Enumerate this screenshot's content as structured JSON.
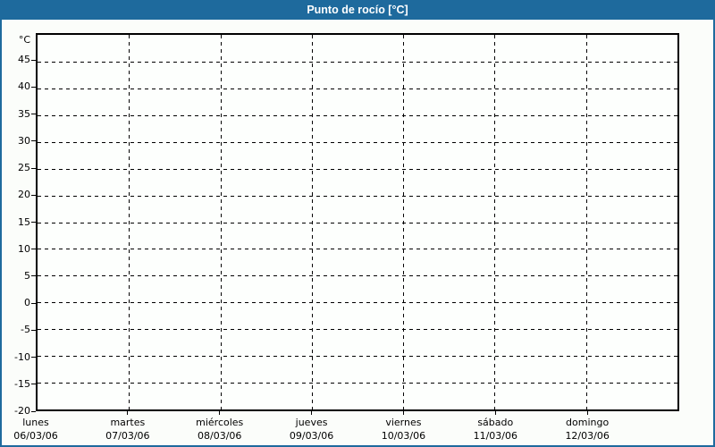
{
  "colors": {
    "frame_blue": "#1e6a9d",
    "title_text": "#ffffff",
    "background": "#fbfdfa",
    "plot_background": "#fdfffd",
    "axis_and_grid": "#000000"
  },
  "chart_data": {
    "type": "line",
    "title": "Punto de rocío [°C]",
    "grid": "dashed-black-horizontal-and-vertical",
    "legend_position": "none",
    "y_axis": {
      "unit_label": "°C",
      "min": -20,
      "max": 50,
      "tick_step": 5,
      "tick_labels": [
        "45",
        "40",
        "35",
        "30",
        "25",
        "20",
        "15",
        "10",
        "5",
        "0",
        "-5",
        "-10",
        "-15",
        "-20"
      ]
    },
    "x_axis": {
      "days": [
        {
          "name": "lunes",
          "date": "06/03/06"
        },
        {
          "name": "martes",
          "date": "07/03/06"
        },
        {
          "name": "miércoles",
          "date": "08/03/06"
        },
        {
          "name": "jueves",
          "date": "09/03/06"
        },
        {
          "name": "viernes",
          "date": "10/03/06"
        },
        {
          "name": "sábado",
          "date": "11/03/06"
        },
        {
          "name": "domingo",
          "date": "12/03/06"
        }
      ]
    },
    "series": []
  }
}
